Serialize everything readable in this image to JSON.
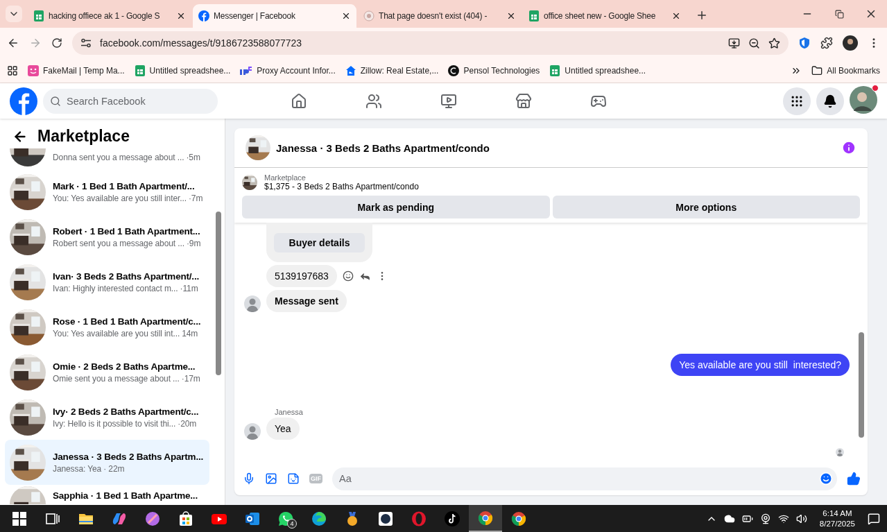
{
  "browser": {
    "tabs": [
      {
        "title": "hacking offiece ak 1 - Google S",
        "kind": "sheets",
        "selected": false
      },
      {
        "title": "Messenger | Facebook",
        "kind": "facebook",
        "selected": true
      },
      {
        "title": "That page doesn't exist (404) -",
        "kind": "error",
        "selected": false
      },
      {
        "title": "office sheet new - Google Shee",
        "kind": "sheets",
        "selected": false
      }
    ],
    "address": "facebook.com/messages/t/9186723588077723",
    "bookmarks": [
      {
        "label": "FakeMail | Temp Ma...",
        "kind": "fakemail"
      },
      {
        "label": "Untitled spreadshee...",
        "kind": "sheets"
      },
      {
        "label": "Proxy Account Infor...",
        "kind": "proxy"
      },
      {
        "label": "Zillow: Real Estate,...",
        "kind": "zillow"
      },
      {
        "label": "Pensol Technologies",
        "kind": "pensol"
      },
      {
        "label": "Untitled spreadshee...",
        "kind": "sheets"
      }
    ],
    "all_bookmarks": "All Bookmarks"
  },
  "header": {
    "search": {
      "placeholder": "Search Facebook"
    }
  },
  "sidebar": {
    "title": "Marketplace",
    "conversations": [
      {
        "kind": "cut-top",
        "snippet": "Donna sent you a message about ...",
        "time": "·5m",
        "selected": false
      },
      {
        "kind": "full",
        "title": "Mark · 1 Bed 1 Bath Apartment/...",
        "snippet": "You: Yes available are you still inter...",
        "time": "·7m",
        "selected": false
      },
      {
        "kind": "full",
        "title": "Robert · 1 Bed 1 Bath Apartment...",
        "snippet": "Robert sent you a message about ...",
        "time": "·9m",
        "selected": false
      },
      {
        "kind": "full",
        "title": "Ivan· 3 Beds 2 Baths Apartment/...",
        "snippet": "Ivan: Highly interested contact m...",
        "time": "·11m",
        "selected": false
      },
      {
        "kind": "full",
        "title": "Rose · 1 Bed 1 Bath Apartment/c...",
        "snippet": "You: Yes available are you still int...",
        "time": "14m",
        "selected": false
      },
      {
        "kind": "full",
        "title": "Omie · 2 Beds 2 Baths Apartme...",
        "snippet": "Omie sent you a message about ...",
        "time": "·17m",
        "selected": false
      },
      {
        "kind": "full",
        "title": "Ivy· 2 Beds 2 Baths Apartment/c...",
        "snippet": "Ivy: Hello is it possible to visit thi...",
        "time": "·20m",
        "selected": false
      },
      {
        "kind": "full",
        "title": "Janessa · 3 Beds 2 Baths Apartm...",
        "snippet": "Janessa: Yea",
        "time": "· 22m",
        "selected": true
      },
      {
        "kind": "cut-bottom",
        "title": "Sapphia · 1 Bed 1 Bath Apartme...",
        "selected": false
      }
    ]
  },
  "chat": {
    "title": "Janessa · 3 Beds 2 Baths Apartment/condo",
    "listing": {
      "label": "Marketplace",
      "detail": "$1,375 - 3 Beds 2 Baths Apartment/condo"
    },
    "actions": [
      "Mark as pending",
      "More options"
    ],
    "messages": [
      {
        "kind": "card",
        "button": "Buyer details"
      },
      {
        "kind": "incoming",
        "text": "5139197683",
        "avatar": false,
        "hover_tools": true,
        "bold": false
      },
      {
        "kind": "incoming",
        "text": "Message sent",
        "avatar": true,
        "hover_tools": false,
        "bold": true
      },
      {
        "kind": "outgoing",
        "text": "Yes available are you still  interested?"
      },
      {
        "kind": "incoming",
        "sender": "Janessa",
        "text": "Yea",
        "avatar": true,
        "hover_tools": false,
        "bold": false
      }
    ],
    "composer": {
      "placeholder": "Aa",
      "gif_label": "GIF"
    }
  },
  "taskbar": {
    "apps": [
      {
        "kind": "start",
        "active": false
      },
      {
        "kind": "taskview",
        "active": false
      },
      {
        "kind": "explorer",
        "active": false
      },
      {
        "kind": "copilot",
        "active": false
      },
      {
        "kind": "orb",
        "active": false
      },
      {
        "kind": "store",
        "active": false
      },
      {
        "kind": "youtube",
        "active": false
      },
      {
        "kind": "outlook",
        "active": false
      },
      {
        "kind": "whatsapp",
        "active": false,
        "badge": "4"
      },
      {
        "kind": "edge",
        "active": false
      },
      {
        "kind": "medal",
        "active": false
      },
      {
        "kind": "darkapp",
        "active": false
      },
      {
        "kind": "opera",
        "active": false
      },
      {
        "kind": "tiktok",
        "active": false
      },
      {
        "kind": "chrome",
        "active": true
      },
      {
        "kind": "chrome",
        "active": false
      }
    ],
    "time": "6:14 AM",
    "date": "8/27/2025"
  }
}
